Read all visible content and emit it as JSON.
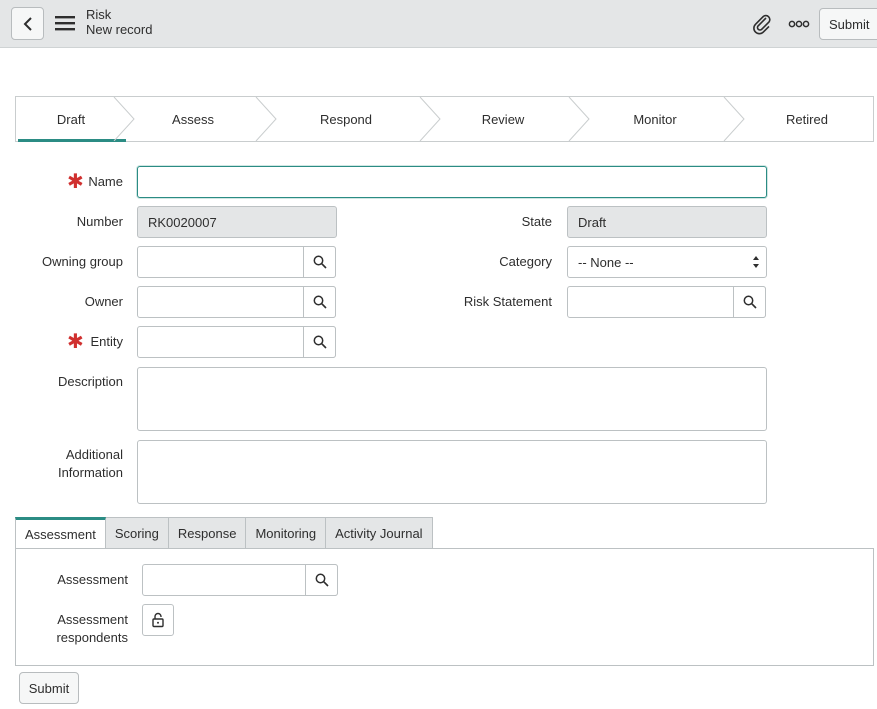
{
  "header": {
    "title": "Risk",
    "subtitle": "New record",
    "submit_label": "Submit",
    "icons": [
      "back-icon",
      "hamburger-menu-icon",
      "paperclip-icon",
      "more-options-icon"
    ]
  },
  "stages": [
    {
      "label": "Draft",
      "active": true
    },
    {
      "label": "Assess",
      "active": false
    },
    {
      "label": "Respond",
      "active": false
    },
    {
      "label": "Review",
      "active": false
    },
    {
      "label": "Monitor",
      "active": false
    },
    {
      "label": "Retired",
      "active": false
    }
  ],
  "form": {
    "name": {
      "label": "Name",
      "value": "",
      "required": true
    },
    "number": {
      "label": "Number",
      "value": "RK0020007"
    },
    "state": {
      "label": "State",
      "value": "Draft"
    },
    "owning_group": {
      "label": "Owning group",
      "value": ""
    },
    "category": {
      "label": "Category",
      "value": "-- None --"
    },
    "owner": {
      "label": "Owner",
      "value": ""
    },
    "risk_statement": {
      "label": "Risk Statement",
      "value": ""
    },
    "entity": {
      "label": "Entity",
      "value": "",
      "required": true
    },
    "description": {
      "label": "Description",
      "value": ""
    },
    "additional_information": {
      "label_line1": "Additional",
      "label_line2": "Information",
      "value": ""
    }
  },
  "tabs": [
    {
      "label": "Assessment",
      "active": true
    },
    {
      "label": "Scoring",
      "active": false
    },
    {
      "label": "Response",
      "active": false
    },
    {
      "label": "Monitoring",
      "active": false
    },
    {
      "label": "Activity Journal",
      "active": false
    }
  ],
  "assessment_tab": {
    "assessment": {
      "label": "Assessment",
      "value": ""
    },
    "respondents": {
      "label_line1": "Assessment",
      "label_line2": "respondents"
    }
  },
  "footer": {
    "submit_label": "Submit"
  },
  "colors": {
    "accent": "#2b8c84",
    "required": "#d0302f",
    "header_bg": "#e4e6e7"
  }
}
